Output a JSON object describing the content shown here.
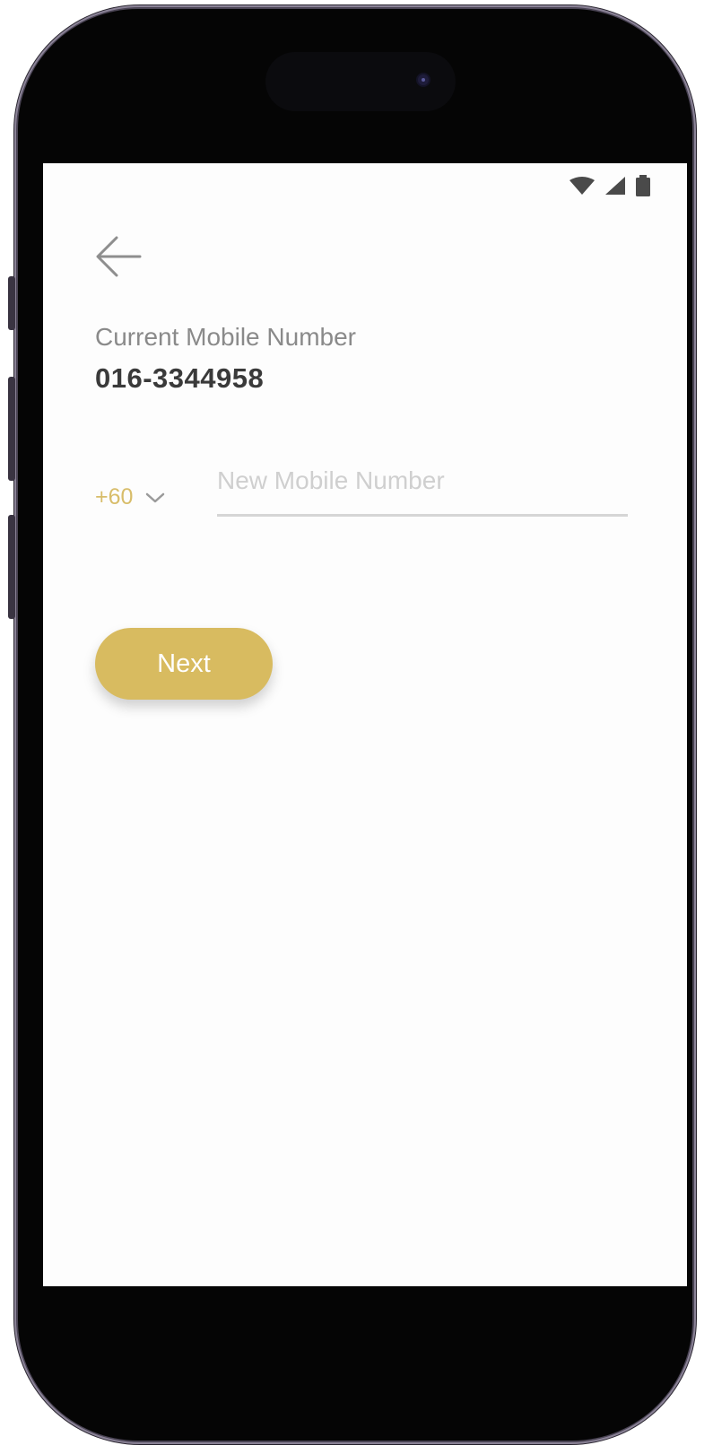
{
  "status_bar": {
    "icons": [
      "wifi-icon",
      "signal-icon",
      "battery-icon"
    ]
  },
  "header": {
    "back_icon": "arrow-left-icon"
  },
  "current": {
    "label": "Current Mobile Number",
    "value": "016-3344958"
  },
  "form": {
    "country_code": "+60",
    "country_code_icon": "chevron-down-icon",
    "new_number_value": "",
    "new_number_placeholder": "New Mobile Number"
  },
  "actions": {
    "next_label": "Next"
  },
  "colors": {
    "accent": "#d8bb60",
    "country_code": "#d8bd6a",
    "label": "#8a8a8a",
    "value": "#3a3a3a",
    "frame": "#4a4454"
  }
}
